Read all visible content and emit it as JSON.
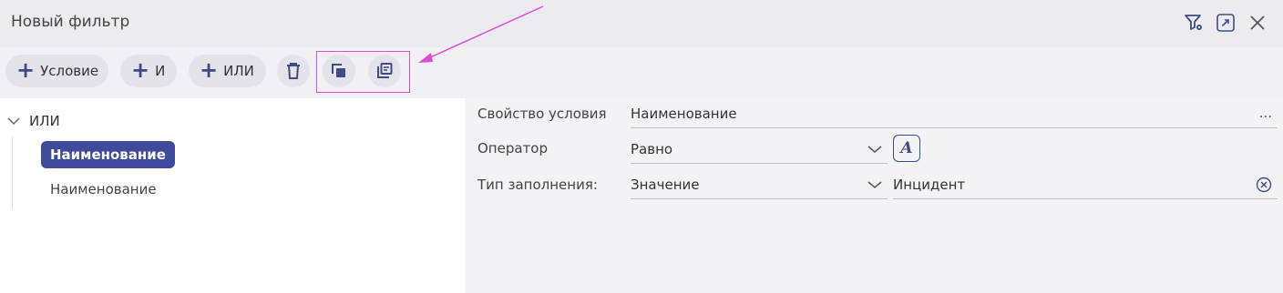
{
  "window": {
    "title": "Новый фильтр"
  },
  "toolbar": {
    "add_condition_label": "Условие",
    "add_and_label": "И",
    "add_or_label": "ИЛИ"
  },
  "tree": {
    "root_label": "ИЛИ",
    "nodes": [
      {
        "label": "Наименование",
        "selected": true
      },
      {
        "label": "Наименование",
        "selected": false
      }
    ]
  },
  "form": {
    "property_label": "Свойство условия",
    "property_value": "Наименование",
    "property_more": "...",
    "operator_label": "Оператор",
    "operator_value": "Равно",
    "fill_type_label": "Тип заполнения:",
    "fill_type_value": "Значение",
    "value_text": "Инцидент",
    "case_button_label": "A"
  },
  "colors": {
    "accent": "#3e4a9a",
    "highlight": "#e04ad8"
  }
}
